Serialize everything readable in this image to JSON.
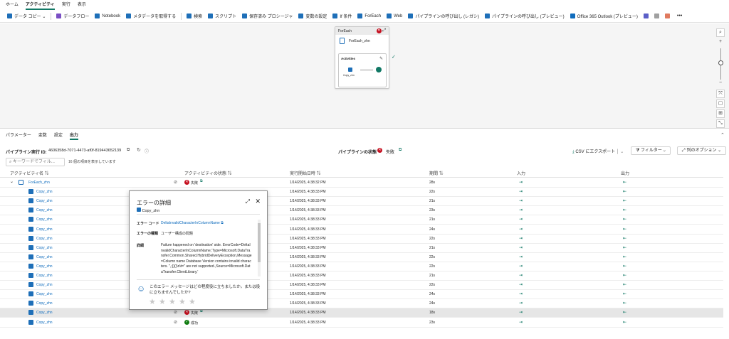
{
  "top_tabs": [
    "ホーム",
    "アクティビティ",
    "実行",
    "表示"
  ],
  "toolbar": [
    {
      "label": "データ コピー ⌄",
      "icon": "copy-data-icon",
      "color": "#1e6fb8"
    },
    {
      "label": "データフロー",
      "icon": "dataflow-icon",
      "color": "#7a4fc4"
    },
    {
      "label": "Notebook",
      "icon": "notebook-icon",
      "color": "#1e6fb8"
    },
    {
      "label": "メタデータを取得する",
      "icon": "info-icon",
      "color": "#1e6fb8"
    },
    {
      "label": "検索",
      "icon": "search-icon",
      "color": "#1e6fb8"
    },
    {
      "label": "スクリプト",
      "icon": "script-icon",
      "color": "#1e6fb8"
    },
    {
      "label": "保存済み プロシージャ",
      "icon": "procedure-icon",
      "color": "#1e6fb8"
    },
    {
      "label": "変数の設定",
      "icon": "variable-icon",
      "color": "#1e6fb8"
    },
    {
      "label": "If 条件",
      "icon": "if-icon",
      "color": "#1e6fb8"
    },
    {
      "label": "ForEach",
      "icon": "foreach-icon",
      "color": "#1e6fb8"
    },
    {
      "label": "Web",
      "icon": "web-icon",
      "color": "#1e6fb8"
    },
    {
      "label": "パイプラインの呼び出し (レガシ)",
      "icon": "pipeline-icon",
      "color": "#1e6fb8"
    },
    {
      "label": "パイプラインの呼び出し (プレビュー)",
      "icon": "pipeline-icon",
      "color": "#1e6fb8"
    },
    {
      "label": "Office 365 Outlook (プレビュー)",
      "icon": "outlook-icon",
      "color": "#0f6cbd"
    }
  ],
  "more": "•••",
  "foreach": {
    "title": "ForEach",
    "name": "ForEach_zhn",
    "activities_label": "Activities",
    "inner": "Copy_zhn"
  },
  "bottom_tabs": [
    "パラメーター",
    "変数",
    "設定",
    "出力"
  ],
  "run": {
    "label": "パイプライン実行 ID:",
    "id": "4606358d-7071-4473-af0f-819443652139",
    "status_label": "パイプラインの状態",
    "status": "失敗",
    "export": "CSV にエクスポート",
    "filter": "フィルター",
    "columns": "列のオプション"
  },
  "search_placeholder": "キーワードでフィル...",
  "count_text": "16 個の項目を表示しています",
  "headers": {
    "name": "アクティビティ名",
    "status": "アクティビティの状態",
    "start": "実行開始日時",
    "duration": "期間",
    "input": "入力",
    "output": "出力"
  },
  "rows": [
    {
      "name": "ForEach_zhn",
      "status": "失敗",
      "start": "1/14/2025, 4:38:32 PM",
      "duration": "28s",
      "parent": true
    },
    {
      "name": "Copy_zhn",
      "status": "",
      "start": "1/14/2025, 4:38:33 PM",
      "duration": "22s"
    },
    {
      "name": "Copy_zhn",
      "status": "",
      "start": "1/14/2025, 4:38:33 PM",
      "duration": "21s"
    },
    {
      "name": "Copy_zhn",
      "status": "",
      "start": "1/14/2025, 4:38:33 PM",
      "duration": "23s"
    },
    {
      "name": "Copy_zhn",
      "status": "",
      "start": "1/14/2025, 4:38:33 PM",
      "duration": "21s"
    },
    {
      "name": "Copy_zhn",
      "status": "",
      "start": "1/14/2025, 4:38:33 PM",
      "duration": "24s"
    },
    {
      "name": "Copy_zhn",
      "status": "",
      "start": "1/14/2025, 4:38:33 PM",
      "duration": "22s"
    },
    {
      "name": "Copy_zhn",
      "status": "",
      "start": "1/14/2025, 4:38:33 PM",
      "duration": "21s"
    },
    {
      "name": "Copy_zhn",
      "status": "",
      "start": "1/14/2025, 4:38:33 PM",
      "duration": "22s"
    },
    {
      "name": "Copy_zhn",
      "status": "",
      "start": "1/14/2025, 4:38:33 PM",
      "duration": "22s"
    },
    {
      "name": "Copy_zhn",
      "status": "",
      "start": "1/14/2025, 4:38:33 PM",
      "duration": "21s"
    },
    {
      "name": "Copy_zhn",
      "status": "",
      "start": "1/14/2025, 4:38:33 PM",
      "duration": "22s"
    },
    {
      "name": "Copy_zhn",
      "status": "",
      "start": "1/14/2025, 4:38:33 PM",
      "duration": "24s"
    },
    {
      "name": "Copy_zhn",
      "status": "",
      "start": "1/14/2025, 4:38:33 PM",
      "duration": "24s"
    },
    {
      "name": "Copy_zhn",
      "status": "失敗",
      "start": "1/14/2025, 4:38:33 PM",
      "duration": "18s",
      "selected": true
    },
    {
      "name": "Copy_zhn",
      "status": "成功",
      "start": "1/14/2025, 4:38:33 PM",
      "duration": "23s"
    }
  ],
  "error": {
    "title": "エラーの詳細",
    "activity": "Copy_zhn",
    "code_label": "エラー コード",
    "code": "DeltaInvalidCharacterInColumnName",
    "type_label": "エラーの種類",
    "type": "ユーザー構成の問題",
    "detail_label": "詳細",
    "detail": "Failure happened on 'destination' side. ErrorCode=DeltaInvalidCharacterInColumnName,'Type=Microsoft.DataTransfer.Common.Shared.HybridDeliveryException,Message=Column name Database Version contains invalid characters. \",;{}()\\n\\t=\" are not supported.,Source=Microsoft.DataTransfer.ClientLibrary,'",
    "feedback": "このエラー メッセージはどの程度役に立ちましたか。または役に立ちませんでしたか?"
  }
}
